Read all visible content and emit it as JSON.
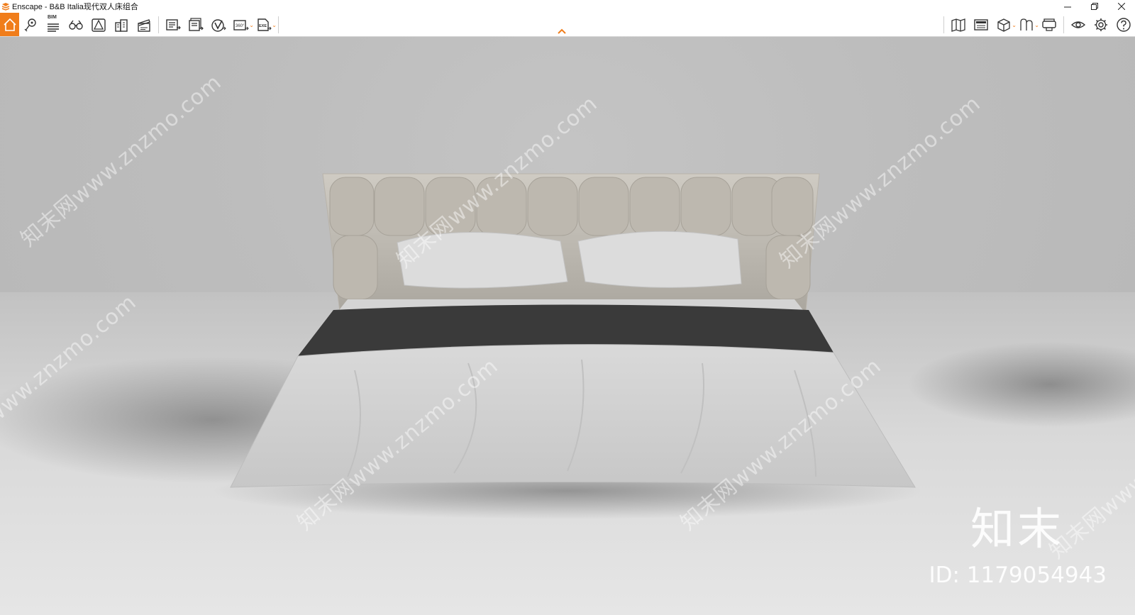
{
  "window": {
    "title": "Enscape - B&B Italia现代双人床组合",
    "controls": [
      "minimize-icon",
      "restore-icon",
      "close-icon"
    ]
  },
  "toolbar": {
    "accent": "#f07d1b",
    "left_tools": [
      {
        "name": "home",
        "icon": "home-icon"
      },
      {
        "name": "views",
        "icon": "location-pin-icon"
      },
      {
        "name": "bim",
        "icon": "bim-list-icon",
        "label": "BIM"
      },
      {
        "name": "binoculars",
        "icon": "binoculars-icon"
      },
      {
        "name": "asset-library",
        "icon": "asset-library-icon"
      },
      {
        "name": "buildings",
        "icon": "buildings-icon"
      },
      {
        "name": "video-editor",
        "icon": "clapperboard-icon"
      }
    ],
    "export_tools": [
      {
        "name": "screenshot",
        "icon": "screenshot-icon"
      },
      {
        "name": "batch-render",
        "icon": "batch-render-icon"
      },
      {
        "name": "web-standalone",
        "icon": "web-export-icon"
      },
      {
        "name": "panorama",
        "icon": "panorama-360-icon",
        "label": "360°"
      },
      {
        "name": "exe-export",
        "icon": "exe-export-icon",
        "label": "EXE"
      }
    ],
    "right_tools": [
      {
        "name": "map",
        "icon": "map-icon"
      },
      {
        "name": "capture",
        "icon": "capture-icon"
      },
      {
        "name": "view-cube",
        "icon": "cube-icon"
      },
      {
        "name": "materials",
        "icon": "material-icon"
      },
      {
        "name": "vr",
        "icon": "vr-headset-icon"
      },
      {
        "name": "visual-settings",
        "icon": "eye-icon"
      },
      {
        "name": "settings",
        "icon": "gear-icon"
      },
      {
        "name": "help",
        "icon": "help-icon"
      }
    ]
  },
  "viewport": {
    "watermark_text": "知末网www.znzmo.com",
    "brand": "知末",
    "brand_id": "ID: 1179054943"
  }
}
